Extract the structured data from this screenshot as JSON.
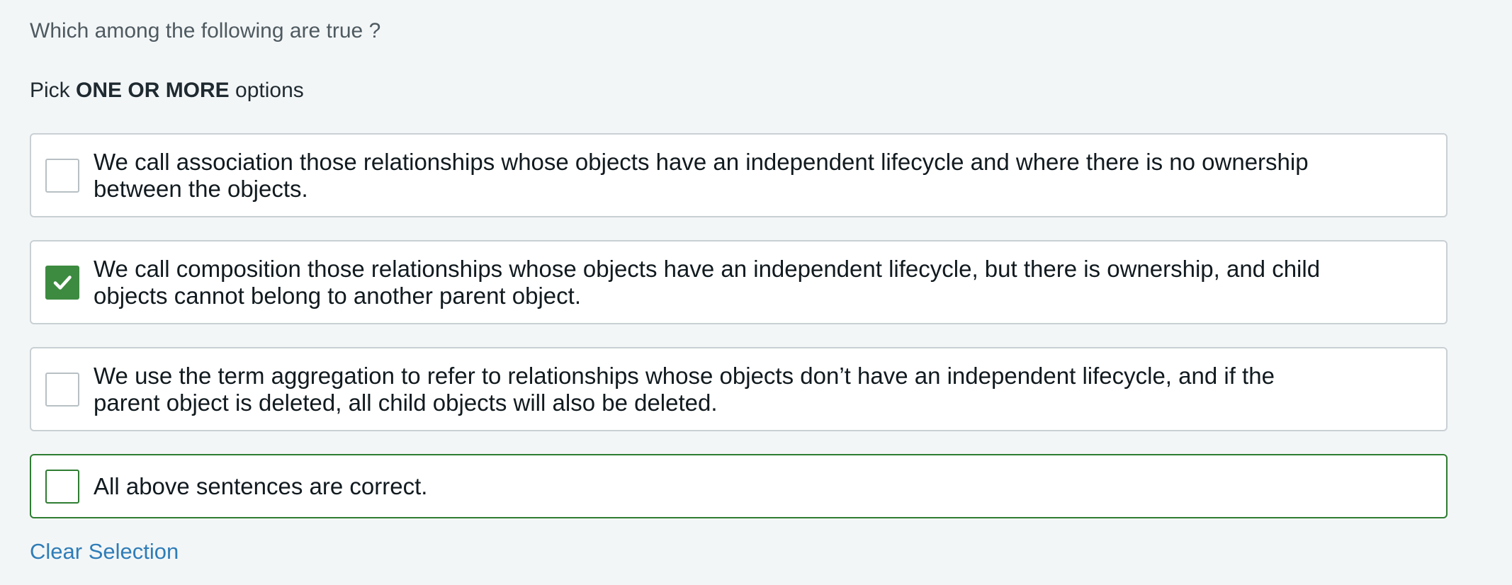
{
  "question": "Which among the following are true ?",
  "instruction": {
    "prefix": "Pick ",
    "emphasis": "ONE OR MORE",
    "suffix": " options"
  },
  "options": [
    {
      "text": "We call association those relationships whose objects have an independent lifecycle and where there is no ownership between the objects.",
      "checked": false
    },
    {
      "text": "We call composition those relationships whose objects have an independent lifecycle, but there is ownership, and child objects cannot belong to another parent object.",
      "checked": true
    },
    {
      "text": "We use the term aggregation to refer to relationships whose objects don’t have an independent lifecycle, and if the parent object is deleted, all child objects will also be deleted.",
      "checked": false
    },
    {
      "text": "All above sentences are correct.",
      "checked": false
    }
  ],
  "clear_selection": "Clear Selection",
  "colors": {
    "background": "#f3f6f7",
    "checked_green": "#3d8b40",
    "highlight_border": "#2e7d32",
    "link_blue": "#2f7db8"
  },
  "icons": {
    "checkmark": "check-icon"
  }
}
